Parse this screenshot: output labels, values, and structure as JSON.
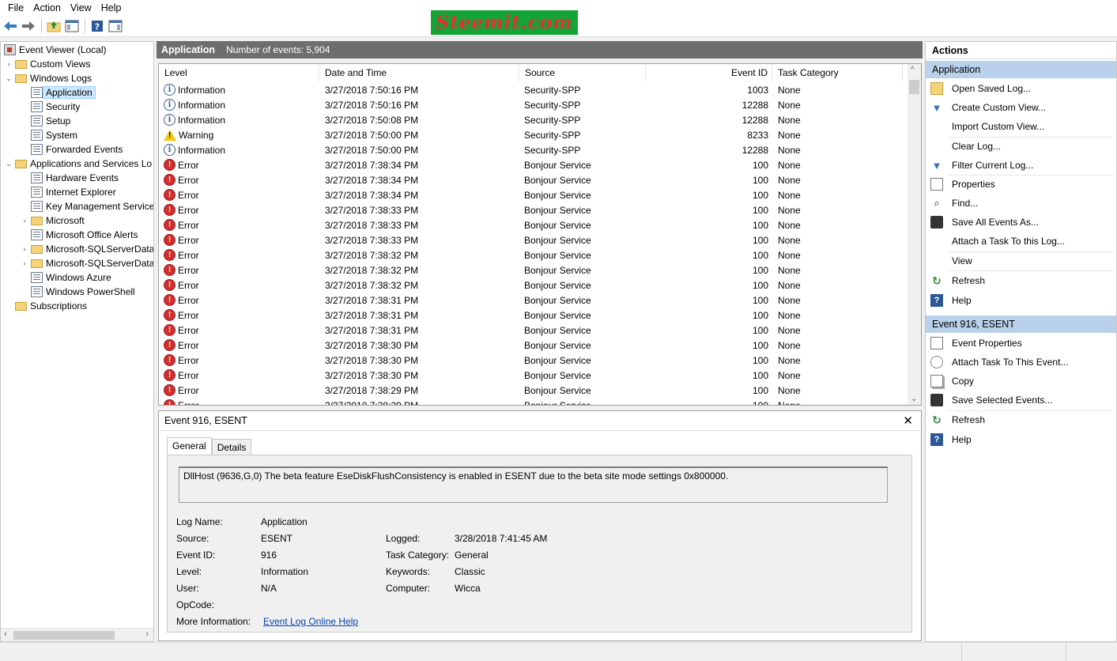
{
  "menu": [
    "File",
    "Action",
    "View",
    "Help"
  ],
  "watermark": "Steemit.com",
  "tree": {
    "nodes": [
      {
        "label": "Event Viewer (Local)",
        "icon": "root-icon",
        "expander": ""
      },
      {
        "label": "Custom Views",
        "icon": "folder-icon",
        "expander": "›"
      },
      {
        "label": "Windows Logs",
        "icon": "folder-icon",
        "expander": "⌄"
      },
      {
        "label": "Application",
        "icon": "log-icon",
        "expander": "",
        "selected": true
      },
      {
        "label": "Security",
        "icon": "log-icon",
        "expander": ""
      },
      {
        "label": "Setup",
        "icon": "log-icon",
        "expander": ""
      },
      {
        "label": "System",
        "icon": "log-icon",
        "expander": ""
      },
      {
        "label": "Forwarded Events",
        "icon": "log-icon",
        "expander": ""
      },
      {
        "label": "Applications and Services Lo",
        "icon": "folder-icon",
        "expander": "⌄"
      },
      {
        "label": "Hardware Events",
        "icon": "log-icon",
        "expander": ""
      },
      {
        "label": "Internet Explorer",
        "icon": "log-icon",
        "expander": ""
      },
      {
        "label": "Key Management Service",
        "icon": "log-icon",
        "expander": ""
      },
      {
        "label": "Microsoft",
        "icon": "folder-icon",
        "expander": "›"
      },
      {
        "label": "Microsoft Office Alerts",
        "icon": "log-icon",
        "expander": ""
      },
      {
        "label": "Microsoft-SQLServerData",
        "icon": "folder-icon",
        "expander": "›"
      },
      {
        "label": "Microsoft-SQLServerData",
        "icon": "folder-icon",
        "expander": "›"
      },
      {
        "label": "Windows Azure",
        "icon": "log-icon",
        "expander": ""
      },
      {
        "label": "Windows PowerShell",
        "icon": "log-icon",
        "expander": ""
      },
      {
        "label": "Subscriptions",
        "icon": "folder-icon",
        "expander": ""
      }
    ]
  },
  "center": {
    "title": "Application",
    "count_text": "Number of events: 5,904"
  },
  "grid": {
    "columns": [
      "Level",
      "Date and Time",
      "Source",
      "Event ID",
      "Task Category"
    ],
    "rows": [
      {
        "level": "Information",
        "kind": "info",
        "date": "3/27/2018 7:50:16 PM",
        "source": "Security-SPP",
        "id": "1003",
        "cat": "None"
      },
      {
        "level": "Information",
        "kind": "info",
        "date": "3/27/2018 7:50:16 PM",
        "source": "Security-SPP",
        "id": "12288",
        "cat": "None"
      },
      {
        "level": "Information",
        "kind": "info",
        "date": "3/27/2018 7:50:08 PM",
        "source": "Security-SPP",
        "id": "12288",
        "cat": "None"
      },
      {
        "level": "Warning",
        "kind": "warn",
        "date": "3/27/2018 7:50:00 PM",
        "source": "Security-SPP",
        "id": "8233",
        "cat": "None"
      },
      {
        "level": "Information",
        "kind": "info",
        "date": "3/27/2018 7:50:00 PM",
        "source": "Security-SPP",
        "id": "12288",
        "cat": "None"
      },
      {
        "level": "Error",
        "kind": "err",
        "date": "3/27/2018 7:38:34 PM",
        "source": "Bonjour Service",
        "id": "100",
        "cat": "None"
      },
      {
        "level": "Error",
        "kind": "err",
        "date": "3/27/2018 7:38:34 PM",
        "source": "Bonjour Service",
        "id": "100",
        "cat": "None"
      },
      {
        "level": "Error",
        "kind": "err",
        "date": "3/27/2018 7:38:34 PM",
        "source": "Bonjour Service",
        "id": "100",
        "cat": "None"
      },
      {
        "level": "Error",
        "kind": "err",
        "date": "3/27/2018 7:38:33 PM",
        "source": "Bonjour Service",
        "id": "100",
        "cat": "None"
      },
      {
        "level": "Error",
        "kind": "err",
        "date": "3/27/2018 7:38:33 PM",
        "source": "Bonjour Service",
        "id": "100",
        "cat": "None"
      },
      {
        "level": "Error",
        "kind": "err",
        "date": "3/27/2018 7:38:33 PM",
        "source": "Bonjour Service",
        "id": "100",
        "cat": "None"
      },
      {
        "level": "Error",
        "kind": "err",
        "date": "3/27/2018 7:38:32 PM",
        "source": "Bonjour Service",
        "id": "100",
        "cat": "None"
      },
      {
        "level": "Error",
        "kind": "err",
        "date": "3/27/2018 7:38:32 PM",
        "source": "Bonjour Service",
        "id": "100",
        "cat": "None"
      },
      {
        "level": "Error",
        "kind": "err",
        "date": "3/27/2018 7:38:32 PM",
        "source": "Bonjour Service",
        "id": "100",
        "cat": "None"
      },
      {
        "level": "Error",
        "kind": "err",
        "date": "3/27/2018 7:38:31 PM",
        "source": "Bonjour Service",
        "id": "100",
        "cat": "None"
      },
      {
        "level": "Error",
        "kind": "err",
        "date": "3/27/2018 7:38:31 PM",
        "source": "Bonjour Service",
        "id": "100",
        "cat": "None"
      },
      {
        "level": "Error",
        "kind": "err",
        "date": "3/27/2018 7:38:31 PM",
        "source": "Bonjour Service",
        "id": "100",
        "cat": "None"
      },
      {
        "level": "Error",
        "kind": "err",
        "date": "3/27/2018 7:38:30 PM",
        "source": "Bonjour Service",
        "id": "100",
        "cat": "None"
      },
      {
        "level": "Error",
        "kind": "err",
        "date": "3/27/2018 7:38:30 PM",
        "source": "Bonjour Service",
        "id": "100",
        "cat": "None"
      },
      {
        "level": "Error",
        "kind": "err",
        "date": "3/27/2018 7:38:30 PM",
        "source": "Bonjour Service",
        "id": "100",
        "cat": "None"
      },
      {
        "level": "Error",
        "kind": "err",
        "date": "3/27/2018 7:38:29 PM",
        "source": "Bonjour Service",
        "id": "100",
        "cat": "None"
      },
      {
        "level": "Error",
        "kind": "err",
        "date": "3/27/2018 7:38:29 PM",
        "source": "Bonjour Service",
        "id": "100",
        "cat": "None"
      }
    ]
  },
  "detail": {
    "title": "Event 916, ESENT",
    "tabs": [
      "General",
      "Details"
    ],
    "message": "DllHost (9636,G,0) The beta feature EseDiskFlushConsistency is enabled in ESENT due to the beta site mode settings 0x800000.",
    "labels": {
      "log_name": "Log Name:",
      "source": "Source:",
      "event_id": "Event ID:",
      "level": "Level:",
      "user": "User:",
      "opcode": "OpCode:",
      "more_info": "More Information:",
      "logged": "Logged:",
      "task_category": "Task Category:",
      "keywords": "Keywords:",
      "computer": "Computer:"
    },
    "values": {
      "log_name": "Application",
      "source": "ESENT",
      "event_id": "916",
      "level": "Information",
      "user": "N/A",
      "opcode": "",
      "more_info_link": "Event Log Online Help",
      "logged": "3/28/2018 7:41:45 AM",
      "task_category": "General",
      "keywords": "Classic",
      "computer": "Wicca"
    }
  },
  "actions": {
    "header": "Actions",
    "section1": {
      "title": "Application",
      "items": [
        {
          "label": "Open Saved Log...",
          "icon": "open-log-icon"
        },
        {
          "label": "Create Custom View...",
          "icon": "filter-icon"
        },
        {
          "label": "Import Custom View...",
          "icon": ""
        },
        {
          "label": "Clear Log...",
          "icon": ""
        },
        {
          "label": "Filter Current Log...",
          "icon": "filter-icon"
        },
        {
          "label": "Properties",
          "icon": "properties-icon"
        },
        {
          "label": "Find...",
          "icon": "find-icon"
        },
        {
          "label": "Save All Events As...",
          "icon": "save-icon"
        },
        {
          "label": "Attach a Task To this Log...",
          "icon": ""
        },
        {
          "label": "View",
          "icon": ""
        },
        {
          "label": "Refresh",
          "icon": "refresh-icon"
        },
        {
          "label": "Help",
          "icon": "help-icon"
        }
      ]
    },
    "section2": {
      "title": "Event 916, ESENT",
      "items": [
        {
          "label": "Event Properties",
          "icon": "properties-icon"
        },
        {
          "label": "Attach Task To This Event...",
          "icon": "attach-task-icon"
        },
        {
          "label": "Copy",
          "icon": "copy-icon"
        },
        {
          "label": "Save Selected Events...",
          "icon": "save-icon"
        },
        {
          "label": "Refresh",
          "icon": "refresh-icon"
        },
        {
          "label": "Help",
          "icon": "help-icon"
        }
      ]
    }
  }
}
